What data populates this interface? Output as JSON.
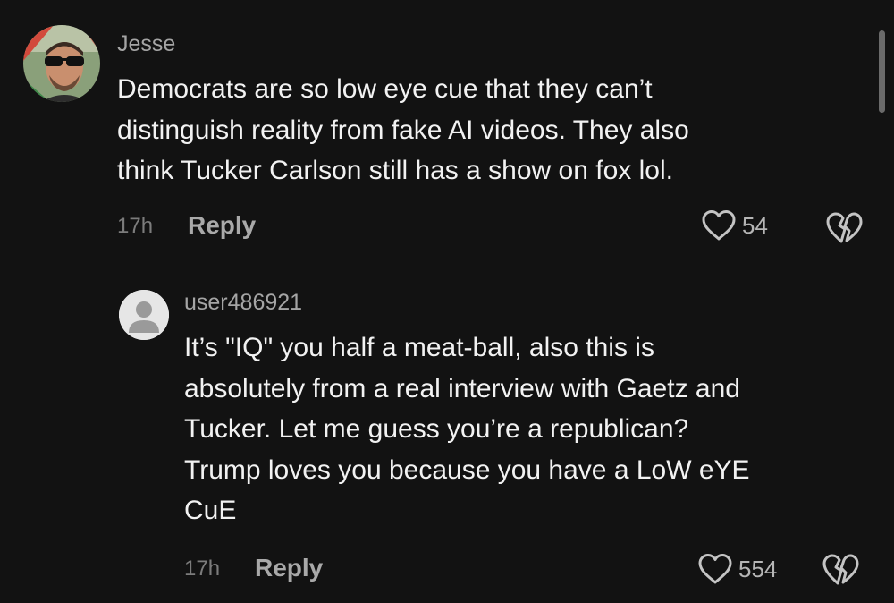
{
  "comments": [
    {
      "username": "Jesse",
      "text_lines": [
        "Democrats are so low eye cue that they can’t",
        "distinguish reality from fake AI videos. They also",
        "think Tucker Carlson still has a show on fox lol."
      ],
      "timestamp": "17h",
      "reply_label": "Reply",
      "like_count": "54",
      "avatar_icon": "user-photo-avatar"
    },
    {
      "username": "user486921",
      "text_lines": [
        "It’s \"IQ\" you half a meat-ball, also this is",
        "absolutely from a real interview with Gaetz and",
        "Tucker. Let me guess you’re a republican?",
        "Trump loves you because you have a LoW eYE",
        "CuE"
      ],
      "timestamp": "17h",
      "reply_label": "Reply",
      "like_count": "554",
      "avatar_icon": "default-user-avatar"
    }
  ],
  "colors": {
    "background": "#121212",
    "text": "#f2f2f2",
    "username": "#a5a5a5",
    "meta": "#7c7c7c"
  }
}
